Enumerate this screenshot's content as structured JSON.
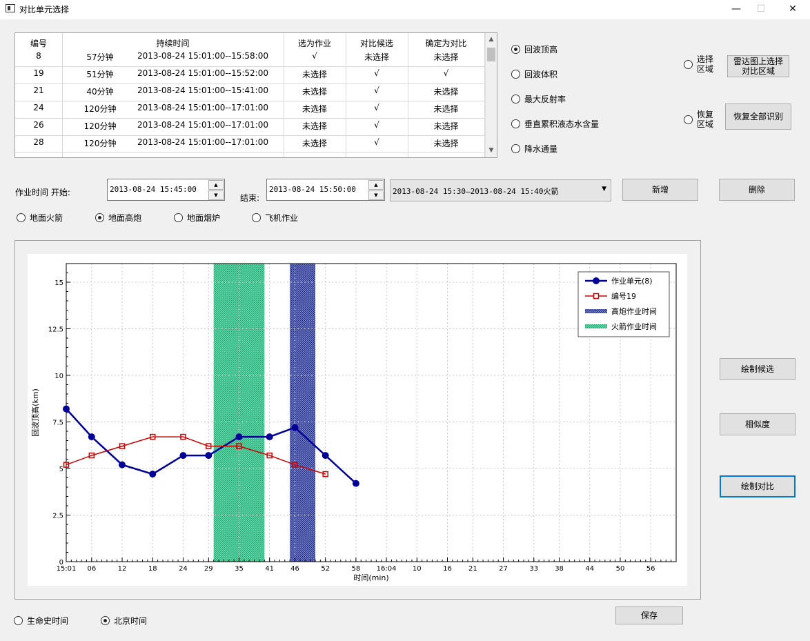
{
  "window": {
    "title": "对比单元选择",
    "minimize": "—",
    "maximize": "☐",
    "close": "✕"
  },
  "table": {
    "headers": [
      "编号",
      "持续时间",
      "选为作业",
      "对比候选",
      "确定为对比"
    ],
    "rows": [
      {
        "id": "8",
        "duration": "57分钟",
        "time": "2013-08-24 15:01:00--15:58:00",
        "as_op": "√",
        "candidate": "未选择",
        "confirmed": "未选择"
      },
      {
        "id": "19",
        "duration": "51分钟",
        "time": "2013-08-24 15:01:00--15:52:00",
        "as_op": "未选择",
        "candidate": "√",
        "confirmed": "√"
      },
      {
        "id": "21",
        "duration": "40分钟",
        "time": "2013-08-24 15:01:00--15:41:00",
        "as_op": "未选择",
        "candidate": "√",
        "confirmed": "未选择"
      },
      {
        "id": "24",
        "duration": "120分钟",
        "time": "2013-08-24 15:01:00--17:01:00",
        "as_op": "未选择",
        "candidate": "√",
        "confirmed": "未选择"
      },
      {
        "id": "26",
        "duration": "120分钟",
        "time": "2013-08-24 15:01:00--17:01:00",
        "as_op": "未选择",
        "candidate": "√",
        "confirmed": "未选择"
      },
      {
        "id": "28",
        "duration": "120分钟",
        "time": "2013-08-24 15:01:00--17:01:00",
        "as_op": "未选择",
        "candidate": "√",
        "confirmed": "未选择"
      }
    ]
  },
  "metrics": [
    {
      "label": "回波顶高",
      "selected": true
    },
    {
      "label": "回波体积",
      "selected": false
    },
    {
      "label": "最大反射率",
      "selected": false
    },
    {
      "label": "垂直累积液态水含量",
      "selected": false
    },
    {
      "label": "降水通量",
      "selected": false
    }
  ],
  "region": {
    "select_radio": "选择\n区域",
    "select_button": "雷达图上选择\n对比区域",
    "restore_radio": "恢复\n区域",
    "restore_button": "恢复全部识别"
  },
  "op_time": {
    "label": "作业时间 开始:",
    "start": "2013-08-24 15:45:00",
    "end_label": "结束:",
    "end": "2013-08-24 15:50:00",
    "combo": "2013-08-24 15:30—2013-08-24 15:40火箭",
    "add": "新增",
    "delete": "删除"
  },
  "op_types": [
    {
      "label": "地面火箭",
      "selected": false
    },
    {
      "label": "地面高炮",
      "selected": true
    },
    {
      "label": "地面烟炉",
      "selected": false
    },
    {
      "label": "飞机作业",
      "selected": false
    }
  ],
  "buttons": {
    "draw_candidates": "绘制候选",
    "similarity": "相似度",
    "draw_compare": "绘制对比",
    "save": "保存"
  },
  "time_mode": [
    {
      "label": "生命史时间",
      "selected": false
    },
    {
      "label": "北京时间",
      "selected": true
    }
  ],
  "chart_data": {
    "type": "line",
    "xlabel": "时间(min)",
    "ylabel": "回波顶高(km)",
    "ylim": [
      0,
      16
    ],
    "yticks": [
      "0",
      "2.5",
      "5",
      "7.5",
      "10",
      "12.5",
      "15"
    ],
    "x_tick_labels": [
      "15:01",
      "06",
      "12",
      "18",
      "24",
      "29",
      "35",
      "41",
      "46",
      "52",
      "58",
      "16:04",
      "10",
      "16",
      "21",
      "27",
      "33",
      "38",
      "44",
      "50",
      "56"
    ],
    "x_tick_minutes": [
      0,
      5,
      11,
      17,
      23,
      28,
      34,
      40,
      45,
      51,
      57,
      63,
      69,
      75,
      80,
      86,
      92,
      97,
      103,
      109,
      115
    ],
    "xlim": [
      0,
      120
    ],
    "grid": true,
    "legend_position": "top-right",
    "series": [
      {
        "name": "作业单元(8)",
        "color": "#000099",
        "marker": "circle",
        "x": [
          0,
          5,
          11,
          17,
          23,
          28,
          34,
          40,
          45,
          51,
          57
        ],
        "y": [
          8.2,
          6.7,
          5.2,
          4.7,
          5.7,
          5.7,
          6.7,
          6.7,
          7.2,
          5.7,
          4.2
        ]
      },
      {
        "name": "编号19",
        "color": "#cc0000",
        "marker": "square",
        "x": [
          0,
          5,
          11,
          17,
          23,
          28,
          34,
          40,
          45,
          51
        ],
        "y": [
          5.2,
          5.7,
          6.2,
          6.7,
          6.7,
          6.2,
          6.2,
          5.7,
          5.2,
          4.7
        ]
      }
    ],
    "bands": [
      {
        "name": "高炮作业时间",
        "color": "#1a237e",
        "x_start": 44,
        "x_end": 49
      },
      {
        "name": "火箭作业时间",
        "color": "#00a86b",
        "x_start": 29,
        "x_end": 39
      }
    ],
    "legend": [
      "作业单元(8)",
      "编号19",
      "高炮作业时间",
      "火箭作业时间"
    ]
  }
}
